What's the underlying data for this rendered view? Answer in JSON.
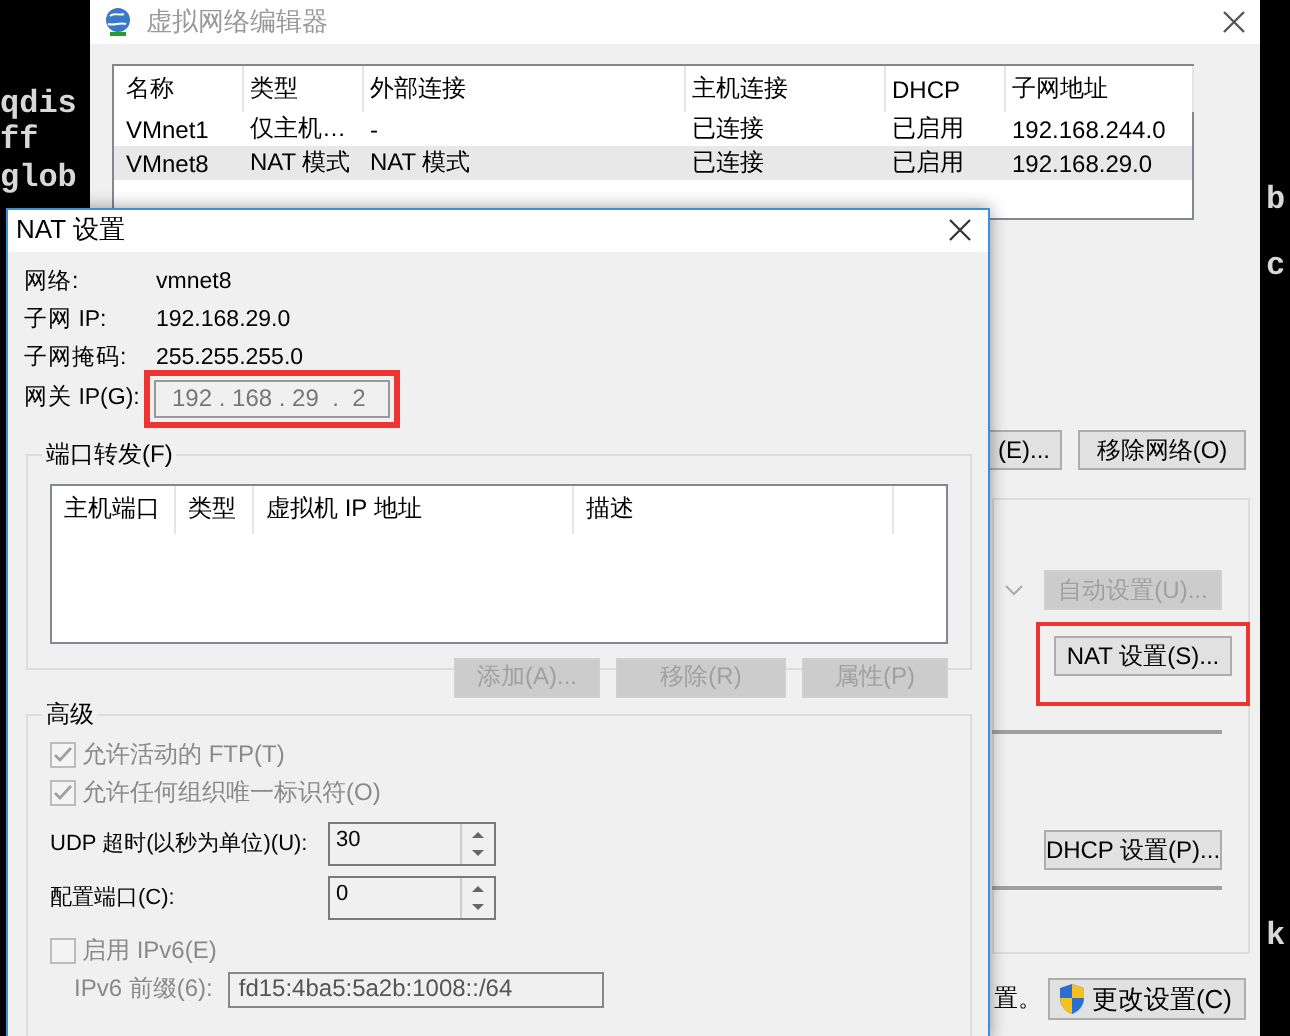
{
  "terminal": {
    "left_lines": [
      "qdis",
      "ff",
      "glob"
    ],
    "right_lines": [
      "b",
      "c",
      "k"
    ]
  },
  "editor": {
    "title": "虚拟网络编辑器",
    "table": {
      "columns": [
        "名称",
        "类型",
        "外部连接",
        "主机连接",
        "DHCP",
        "子网地址"
      ],
      "rows": [
        {
          "cells": [
            "VMnet1",
            "仅主机…",
            "-",
            "已连接",
            "已启用",
            "192.168.244.0"
          ],
          "selected": false
        },
        {
          "cells": [
            "VMnet8",
            "NAT 模式",
            "NAT 模式",
            "已连接",
            "已启用",
            "192.168.29.0"
          ],
          "selected": true
        }
      ]
    },
    "network_buttons": [
      {
        "label": "(E)...",
        "disabled": false
      },
      {
        "label": "移除网络(O)",
        "disabled": false
      }
    ],
    "auto_button": {
      "label": "自动设置(U)...",
      "disabled": true
    },
    "nat_button": {
      "label": "NAT 设置(S)...",
      "highlighted": true
    },
    "dhcp_button": {
      "label": "DHCP 设置(P)..."
    },
    "footer_text": "置。",
    "change_button": {
      "label": "更改设置(C)"
    }
  },
  "nat_dialog": {
    "title": "NAT 设置",
    "info": [
      {
        "label": "网络:",
        "value": "vmnet8"
      },
      {
        "label": "子网 IP:",
        "value": "192.168.29.0"
      },
      {
        "label": "子网掩码:",
        "value": "255.255.255.0"
      }
    ],
    "gateway": {
      "label": "网关 IP(G):",
      "value": "192 . 168 . 29  .  2",
      "highlighted": true
    },
    "port_forwarding": {
      "title": "端口转发(F)",
      "columns": [
        "主机端口",
        "类型",
        "虚拟机 IP 地址",
        "描述"
      ],
      "buttons": [
        {
          "label": "添加(A)...",
          "disabled": true
        },
        {
          "label": "移除(R)",
          "disabled": true
        },
        {
          "label": "属性(P)",
          "disabled": true
        }
      ]
    },
    "advanced": {
      "title": "高级",
      "checkboxes": [
        {
          "label": "允许活动的 FTP(T)",
          "checked": true,
          "disabled": true
        },
        {
          "label": "允许任何组织唯一标识符(O)",
          "checked": true,
          "disabled": true
        }
      ],
      "spins": [
        {
          "label": "UDP 超时(以秒为单位)(U):",
          "value": "30"
        },
        {
          "label": "配置端口(C):",
          "value": "0"
        }
      ],
      "ipv6": {
        "label": "启用 IPv6(E)",
        "checked": false
      },
      "prefix": {
        "label": "IPv6 前缀(6):",
        "value": "fd15:4ba5:5a2b:1008::/64"
      }
    }
  }
}
